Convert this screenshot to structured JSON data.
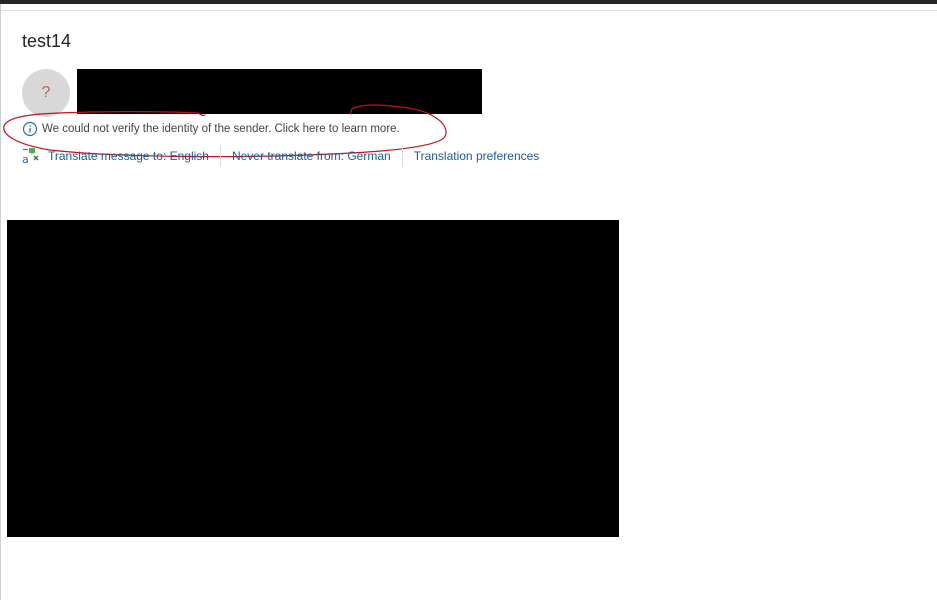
{
  "message": {
    "subject": "test14",
    "avatar_glyph": "?"
  },
  "security_notice": {
    "text": "We could not verify the identity of the sender. Click here to learn more.",
    "icon": "info-circle-icon"
  },
  "translation": {
    "icon": "translate-icon",
    "translate_link": "Translate message to: English",
    "never_translate_link": "Never translate from: German",
    "preferences_link": "Translation preferences"
  },
  "colors": {
    "link": "#1a5a9c",
    "info_icon": "#2b6cb0",
    "annotation": "#c0141e"
  }
}
